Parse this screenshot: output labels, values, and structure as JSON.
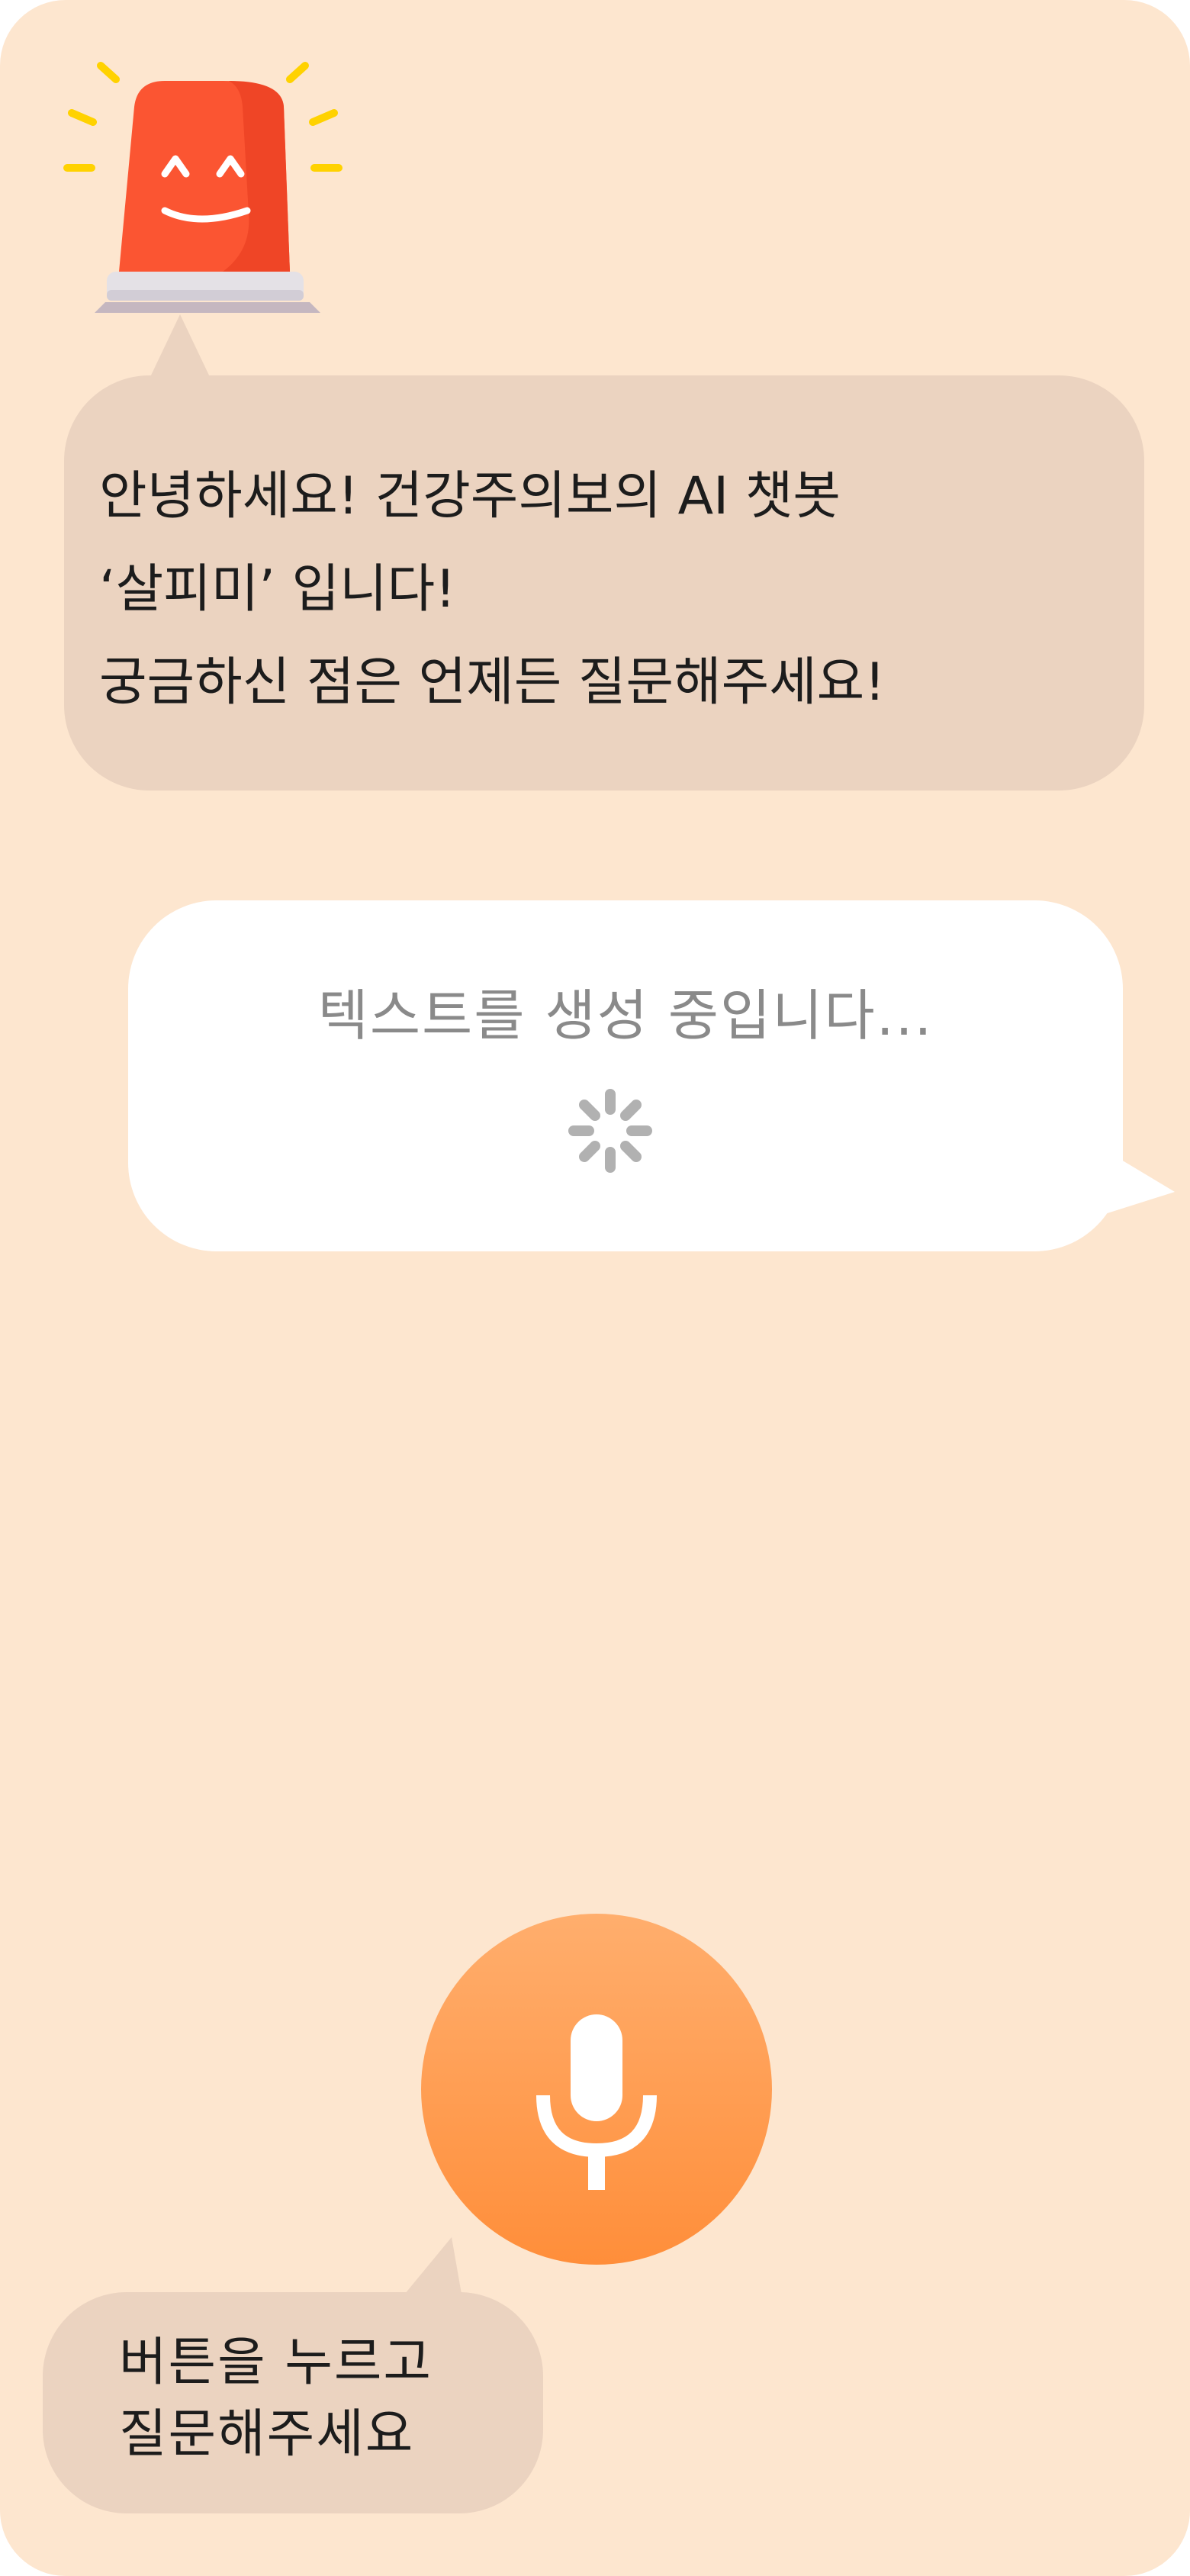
{
  "greeting": {
    "lines": [
      "안녕하세요! 건강주의보의 AI 챗봇",
      "‘살피미’ 입니다!",
      "궁금하신 점은 언제든 질문해주세요!"
    ]
  },
  "loading": {
    "text": "텍스트를 생성 중입니다...",
    "spinner_icon": "loading-spinner-icon"
  },
  "mic": {
    "icon": "microphone-icon"
  },
  "hint": {
    "lines": [
      "버튼을 누르고",
      "질문해주세요"
    ]
  },
  "mascot": {
    "icon": "siren-mascot-icon"
  },
  "colors": {
    "background": "#fde6cf",
    "bubble": "#ebd3c0",
    "mic_top": "#ffae6d",
    "mic_bottom": "#ff8e3a",
    "siren_red": "#fb5532",
    "ray_yellow": "#ffd200"
  }
}
